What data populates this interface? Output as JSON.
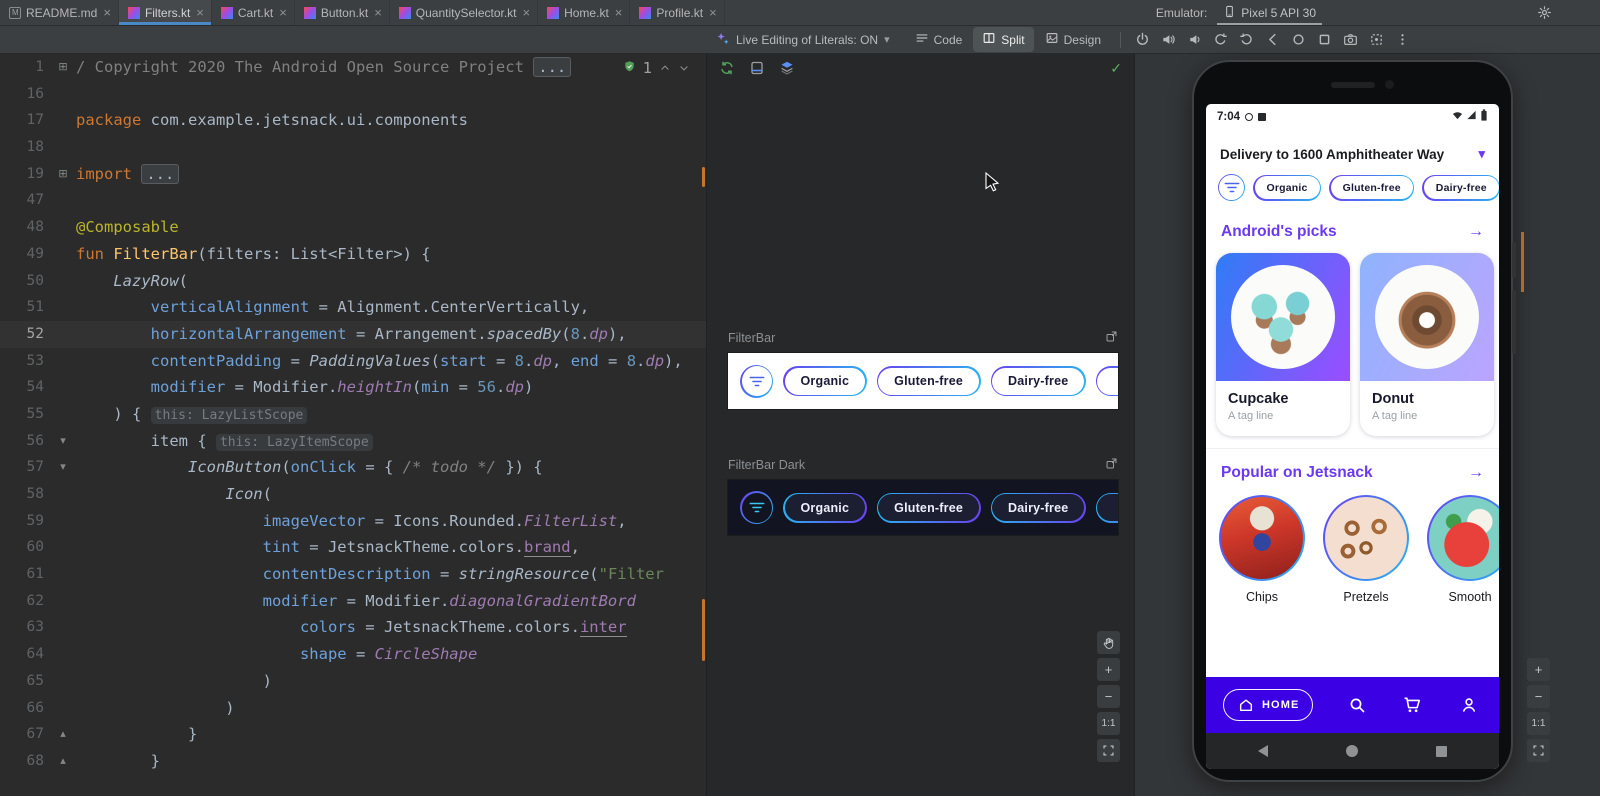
{
  "window": {
    "emulator_label": "Emulator:",
    "device_name": "Pixel 5 API 30"
  },
  "glyphs": {
    "close": "×",
    "chevron_down": "▾",
    "arrow_right": "→",
    "check": "✓",
    "fold_plus": "⊞",
    "fold_down": "▾",
    "fold_up": "▴"
  },
  "zoom_controls": {
    "zoom_in": "+",
    "zoom_out": "−",
    "actual": "1:1"
  },
  "tabs": [
    {
      "label": "README.md",
      "icon": "markdown",
      "active": false
    },
    {
      "label": "Filters.kt",
      "icon": "kotlin",
      "active": true
    },
    {
      "label": "Cart.kt",
      "icon": "kotlin",
      "active": false
    },
    {
      "label": "Button.kt",
      "icon": "kotlin",
      "active": false
    },
    {
      "label": "QuantitySelector.kt",
      "icon": "kotlin",
      "active": false
    },
    {
      "label": "Home.kt",
      "icon": "kotlin",
      "active": false
    },
    {
      "label": "Profile.kt",
      "icon": "kotlin",
      "active": false
    }
  ],
  "toolbar": {
    "live_editing": "Live Editing of Literals: ON",
    "view_modes": [
      {
        "label": "Code",
        "icon": "code-icon",
        "active": false
      },
      {
        "label": "Split",
        "icon": "split-icon",
        "active": true
      },
      {
        "label": "Design",
        "icon": "design-icon",
        "active": false
      }
    ],
    "emulator_controls": [
      "power",
      "volume-up",
      "volume-down",
      "rotate-left",
      "rotate-right",
      "back",
      "home",
      "overview",
      "camera",
      "screenshot",
      "more-vert"
    ]
  },
  "editor": {
    "inspection_count": "1",
    "lines": [
      {
        "n": "1",
        "f": "plus",
        "s": [
          [
            "/ Copyright 2020 The Android Open Source Project ",
            "cm"
          ],
          [
            "...",
            "fold"
          ]
        ]
      },
      {
        "n": "16",
        "s": []
      },
      {
        "n": "17",
        "s": [
          [
            "package ",
            "kw"
          ],
          [
            "com.example.jetsnack.ui.components",
            "d"
          ]
        ]
      },
      {
        "n": "18",
        "s": []
      },
      {
        "n": "19",
        "f": "plus",
        "s": [
          [
            "import ",
            "kw"
          ],
          [
            "...",
            "fold"
          ]
        ]
      },
      {
        "n": "47",
        "s": []
      },
      {
        "n": "48",
        "s": [
          [
            "@Composable",
            "ann"
          ]
        ]
      },
      {
        "n": "49",
        "s": [
          [
            "fun ",
            "kw"
          ],
          [
            "FilterBar",
            "fn"
          ],
          [
            "(filters: List<Filter>) {",
            "d"
          ]
        ]
      },
      {
        "n": "50",
        "s": [
          [
            "    ",
            "d"
          ],
          [
            "LazyRow",
            "it"
          ],
          [
            "(",
            "d"
          ]
        ]
      },
      {
        "n": "51",
        "s": [
          [
            "        ",
            "d"
          ],
          [
            "verticalAlignment",
            "na"
          ],
          [
            " = Alignment.CenterVertically,",
            "d"
          ]
        ]
      },
      {
        "n": "52",
        "cur": true,
        "s": [
          [
            "        ",
            "d"
          ],
          [
            "horizontalArrangement",
            "na"
          ],
          [
            " = Arrangement.",
            "d"
          ],
          [
            "spacedBy",
            "it"
          ],
          [
            "(",
            "d"
          ],
          [
            "8",
            "num"
          ],
          [
            ".",
            "d"
          ],
          [
            "dp",
            "exti"
          ],
          [
            "),",
            "d"
          ]
        ]
      },
      {
        "n": "53",
        "s": [
          [
            "        ",
            "d"
          ],
          [
            "contentPadding",
            "na"
          ],
          [
            " = ",
            "d"
          ],
          [
            "PaddingValues",
            "it"
          ],
          [
            "(",
            "d"
          ],
          [
            "start",
            "na"
          ],
          [
            " = ",
            "d"
          ],
          [
            "8",
            "num"
          ],
          [
            ".",
            "d"
          ],
          [
            "dp",
            "exti"
          ],
          [
            ", ",
            "d"
          ],
          [
            "end",
            "na"
          ],
          [
            " = ",
            "d"
          ],
          [
            "8",
            "num"
          ],
          [
            ".",
            "d"
          ],
          [
            "dp",
            "exti"
          ],
          [
            "),",
            "d"
          ]
        ]
      },
      {
        "n": "54",
        "s": [
          [
            "        ",
            "d"
          ],
          [
            "modifier",
            "na"
          ],
          [
            " = Modifier.",
            "d"
          ],
          [
            "heightIn",
            "exti"
          ],
          [
            "(",
            "d"
          ],
          [
            "min",
            "na"
          ],
          [
            " = ",
            "d"
          ],
          [
            "56",
            "num"
          ],
          [
            ".",
            "d"
          ],
          [
            "dp",
            "exti"
          ],
          [
            ")",
            "d"
          ]
        ]
      },
      {
        "n": "55",
        "s": [
          [
            "    ) { ",
            "d"
          ],
          [
            "this: LazyListScope",
            "inlay"
          ]
        ]
      },
      {
        "n": "56",
        "f": "down",
        "s": [
          [
            "        item { ",
            "d"
          ],
          [
            "this: LazyItemScope",
            "inlay"
          ]
        ]
      },
      {
        "n": "57",
        "f": "down",
        "s": [
          [
            "            ",
            "d"
          ],
          [
            "IconButton",
            "it"
          ],
          [
            "(",
            "d"
          ],
          [
            "onClick",
            "na"
          ],
          [
            " = { ",
            "d"
          ],
          [
            "/* todo */",
            "cmit"
          ],
          [
            " }) {",
            "d"
          ]
        ]
      },
      {
        "n": "58",
        "s": [
          [
            "                ",
            "d"
          ],
          [
            "Icon",
            "it"
          ],
          [
            "(",
            "d"
          ]
        ]
      },
      {
        "n": "59",
        "s": [
          [
            "                    ",
            "d"
          ],
          [
            "imageVector",
            "na"
          ],
          [
            " = Icons.Rounded.",
            "d"
          ],
          [
            "FilterList",
            "exti"
          ],
          [
            ",",
            "d"
          ]
        ]
      },
      {
        "n": "60",
        "s": [
          [
            "                    ",
            "d"
          ],
          [
            "tint",
            "na"
          ],
          [
            " = JetsnackTheme.colors.",
            "d"
          ],
          [
            "brand",
            "extu"
          ],
          [
            ",",
            "d"
          ]
        ]
      },
      {
        "n": "61",
        "s": [
          [
            "                    ",
            "d"
          ],
          [
            "contentDescription",
            "na"
          ],
          [
            " = ",
            "d"
          ],
          [
            "stringResource",
            "it"
          ],
          [
            "(",
            "d"
          ],
          [
            "\"Filter",
            "str"
          ]
        ]
      },
      {
        "n": "62",
        "s": [
          [
            "                    ",
            "d"
          ],
          [
            "modifier",
            "na"
          ],
          [
            " = Modifier.",
            "d"
          ],
          [
            "diagonalGradientBord",
            "exti"
          ]
        ]
      },
      {
        "n": "63",
        "s": [
          [
            "                        ",
            "d"
          ],
          [
            "colors",
            "na"
          ],
          [
            " = JetsnackTheme.colors.",
            "d"
          ],
          [
            "inter",
            "extu"
          ]
        ]
      },
      {
        "n": "64",
        "s": [
          [
            "                        ",
            "d"
          ],
          [
            "shape",
            "na"
          ],
          [
            " = ",
            "d"
          ],
          [
            "CircleShape",
            "exti"
          ]
        ]
      },
      {
        "n": "65",
        "s": [
          [
            "                    )",
            "d"
          ]
        ]
      },
      {
        "n": "66",
        "s": [
          [
            "                )",
            "d"
          ]
        ]
      },
      {
        "n": "67",
        "f": "up",
        "s": [
          [
            "            }",
            "d"
          ]
        ]
      },
      {
        "n": "68",
        "f": "up",
        "s": [
          [
            "        }",
            "d"
          ]
        ]
      }
    ]
  },
  "preview": {
    "previews": [
      {
        "label": "FilterBar",
        "theme": "light",
        "chips": [
          "Organic",
          "Gluten-free",
          "Dairy-free"
        ]
      },
      {
        "label": "FilterBar Dark",
        "theme": "dark",
        "chips": [
          "Organic",
          "Gluten-free",
          "Dairy-free"
        ]
      }
    ]
  },
  "phone": {
    "time": "7:04",
    "delivery": "Delivery to 1600 Amphitheater Way",
    "filters": [
      "Organic",
      "Gluten-free",
      "Dairy-free"
    ],
    "picks_title": "Android's picks",
    "cards": [
      {
        "name": "Cupcake",
        "tag": "A tag line",
        "img": "cupcake"
      },
      {
        "name": "Donut",
        "tag": "A tag line",
        "img": "donut"
      }
    ],
    "popular_title": "Popular on Jetsnack",
    "popular": [
      {
        "name": "Chips",
        "img": "chips"
      },
      {
        "name": "Pretzels",
        "img": "pretzels"
      },
      {
        "name": "Smooth",
        "img": "smoothie"
      }
    ],
    "home_label": "HOME"
  },
  "colors": {
    "accent_purple": "#6b39f4",
    "nav_blue": "#3b00e3",
    "chip_gradient_start": "#6a40f0",
    "chip_gradient_end": "#27b6ef",
    "active_tab_underline": "#4a88c7",
    "change_marker_orange": "#c8752c"
  }
}
